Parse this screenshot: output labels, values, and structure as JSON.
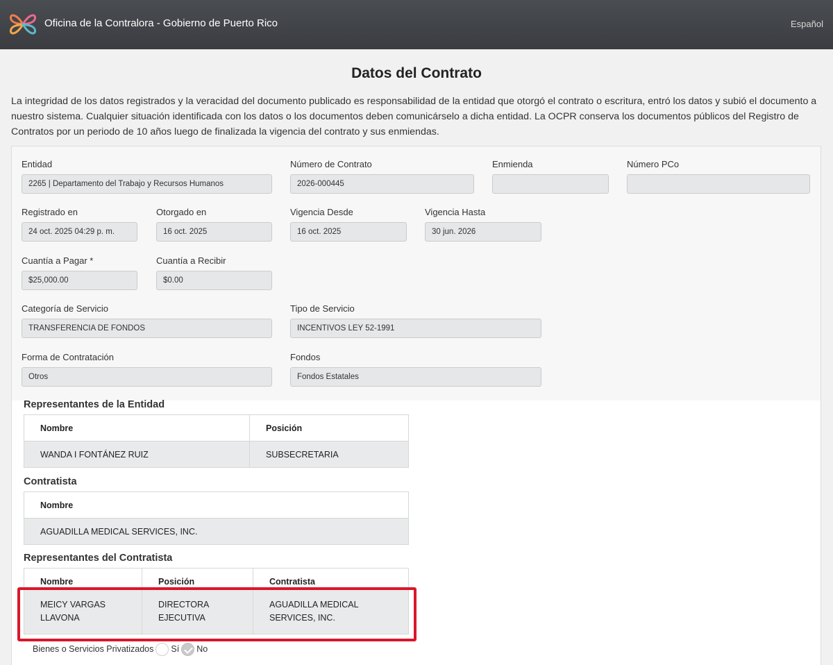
{
  "header": {
    "title": "Oficina de la Contralora - Gobierno de Puerto Rico",
    "language": "Español",
    "logo_icon": "butterfly-logo-icon"
  },
  "page": {
    "title": "Datos del Contrato",
    "disclaimer": "La integridad de los datos registrados y la veracidad del documento publicado es responsabilidad de la entidad que otorgó el contrato o escritura, entró los datos y subió el documento a nuestro sistema. Cualquier situación identificada con los datos o los documentos deben comunicárselo a dicha entidad. La OCPR conserva los documentos públicos del Registro de Contratos por un periodo de 10 años luego de finalizada la vigencia del contrato y sus enmiendas."
  },
  "fields": {
    "entidad": {
      "label": "Entidad",
      "value": "2265 | Departamento del Trabajo y Recursos Humanos"
    },
    "numero_contrato": {
      "label": "Número de Contrato",
      "value": "2026-000445"
    },
    "enmienda": {
      "label": "Enmienda",
      "value": ""
    },
    "numero_pco": {
      "label": "Número PCo",
      "value": ""
    },
    "registrado_en": {
      "label": "Registrado en",
      "value": "24 oct. 2025 04:29 p. m."
    },
    "otorgado_en": {
      "label": "Otorgado en",
      "value": "16 oct. 2025"
    },
    "vigencia_desde": {
      "label": "Vigencia Desde",
      "value": "16 oct. 2025"
    },
    "vigencia_hasta": {
      "label": "Vigencia Hasta",
      "value": "30 jun. 2026"
    },
    "cuantia_pagar": {
      "label": "Cuantía a Pagar *",
      "value": "$25,000.00"
    },
    "cuantia_recibir": {
      "label": "Cuantía a Recibir",
      "value": "$0.00"
    },
    "categoria_servicio": {
      "label": "Categoría de Servicio",
      "value": "TRANSFERENCIA DE FONDOS"
    },
    "tipo_servicio": {
      "label": "Tipo de Servicio",
      "value": "INCENTIVOS LEY 52-1991"
    },
    "forma_contratacion": {
      "label": "Forma de Contratación",
      "value": "Otros"
    },
    "fondos": {
      "label": "Fondos",
      "value": "Fondos Estatales"
    }
  },
  "representantes_entidad": {
    "heading": "Representantes de la Entidad",
    "columns": [
      "Nombre",
      "Posición"
    ],
    "rows": [
      [
        "WANDA I FONTÁNEZ RUIZ",
        "SUBSECRETARIA"
      ]
    ]
  },
  "contratista": {
    "heading": "Contratista",
    "columns": [
      "Nombre"
    ],
    "rows": [
      [
        "AGUADILLA MEDICAL SERVICES, INC."
      ]
    ]
  },
  "representantes_contratista": {
    "heading": "Representantes del Contratista",
    "columns": [
      "Nombre",
      "Posición",
      "Contratista"
    ],
    "rows": [
      [
        "MEICY VARGAS LLAVONA",
        "DIRECTORA EJECUTIVA",
        "AGUADILLA MEDICAL SERVICES, INC."
      ]
    ],
    "highlight_color": "#d9172b"
  },
  "privatizados": {
    "label": "Bienes o Servicios Privatizados",
    "option_yes": "Sí",
    "option_no": "No",
    "selected": "No"
  }
}
